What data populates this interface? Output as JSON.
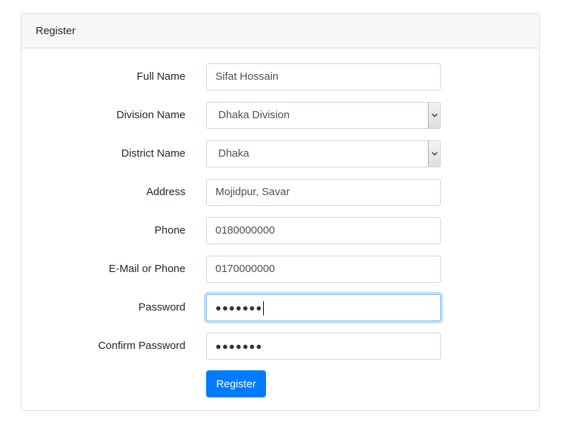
{
  "card": {
    "header_title": "Register"
  },
  "form": {
    "full_name": {
      "label": "Full Name",
      "value": "Sifat Hossain"
    },
    "division": {
      "label": "Division Name",
      "selected": "Dhaka Division"
    },
    "district": {
      "label": "District Name",
      "selected": "Dhaka"
    },
    "address": {
      "label": "Address",
      "value": "Mojidpur, Savar"
    },
    "phone": {
      "label": "Phone",
      "value": "0180000000"
    },
    "email": {
      "label": "E-Mail or Phone",
      "value": "0170000000"
    },
    "password": {
      "label": "Password",
      "masked": "●●●●●●●"
    },
    "confirm_password": {
      "label": "Confirm Password",
      "masked": "●●●●●●●"
    },
    "submit_label": "Register"
  },
  "colors": {
    "primary": "#007bff",
    "focus_border": "#80bdff",
    "header_bg": "#f7f7f7"
  },
  "icons": {
    "select_arrow": "chevron-down-icon"
  }
}
